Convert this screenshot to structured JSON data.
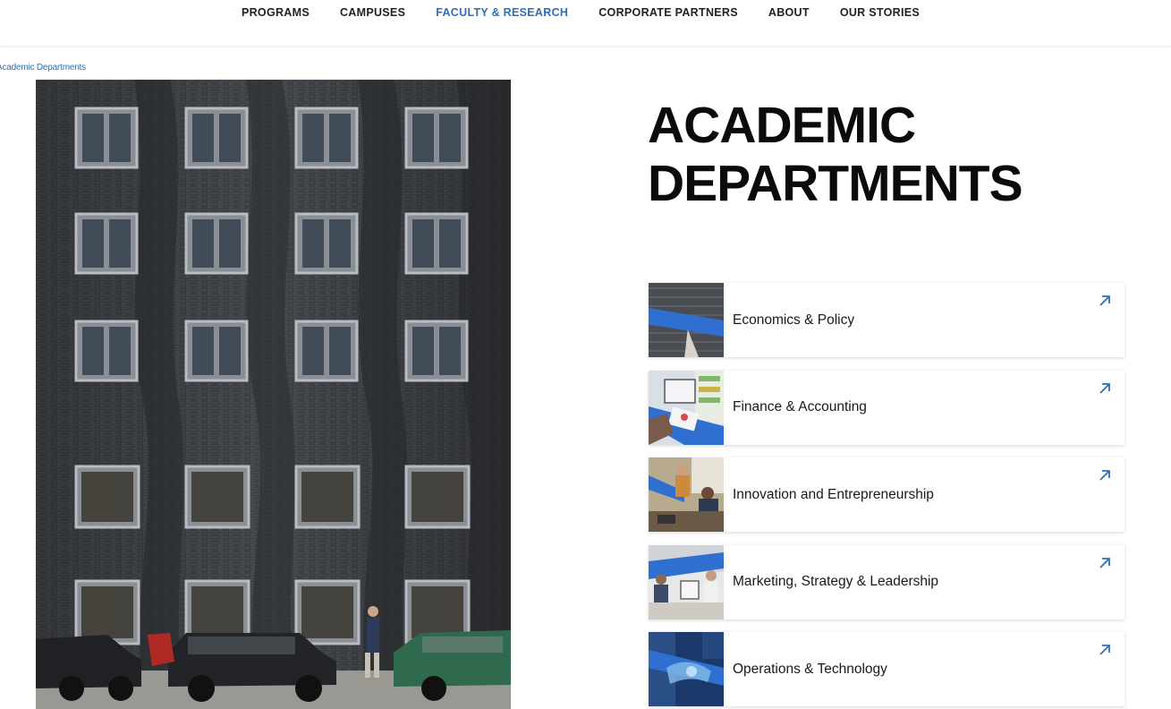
{
  "nav": {
    "items": [
      {
        "label": "PROGRAMS",
        "active": false
      },
      {
        "label": "CAMPUSES",
        "active": false
      },
      {
        "label": "FACULTY & RESEARCH",
        "active": true
      },
      {
        "label": "CORPORATE PARTNERS",
        "active": false
      },
      {
        "label": "ABOUT",
        "active": false
      },
      {
        "label": "OUR STORIES",
        "active": false
      }
    ],
    "active_color": "#2f6fb7"
  },
  "breadcrumb": {
    "current": "Academic Departments"
  },
  "hero": {
    "image": "building-facade-photo"
  },
  "page": {
    "title_line1": "ACADEMIC",
    "title_line2": "DEPARTMENTS"
  },
  "departments": [
    {
      "label": "Economics & Policy",
      "thumb": "brick-wall-blue-ribbon-photo",
      "icon": "arrow-up-right-icon"
    },
    {
      "label": "Finance & Accounting",
      "thumb": "laptop-charts-photo",
      "icon": "arrow-up-right-icon"
    },
    {
      "label": "Innovation and Entrepreneurship",
      "thumb": "students-workshop-photo",
      "icon": "arrow-up-right-icon"
    },
    {
      "label": "Marketing, Strategy & Leadership",
      "thumb": "office-meeting-photo",
      "icon": "arrow-up-right-icon"
    },
    {
      "label": "Operations & Technology",
      "thumb": "hand-tech-photo",
      "icon": "arrow-up-right-icon"
    }
  ],
  "colors": {
    "accent": "#2f6fb7",
    "ribbon": "#2e6fd0"
  }
}
